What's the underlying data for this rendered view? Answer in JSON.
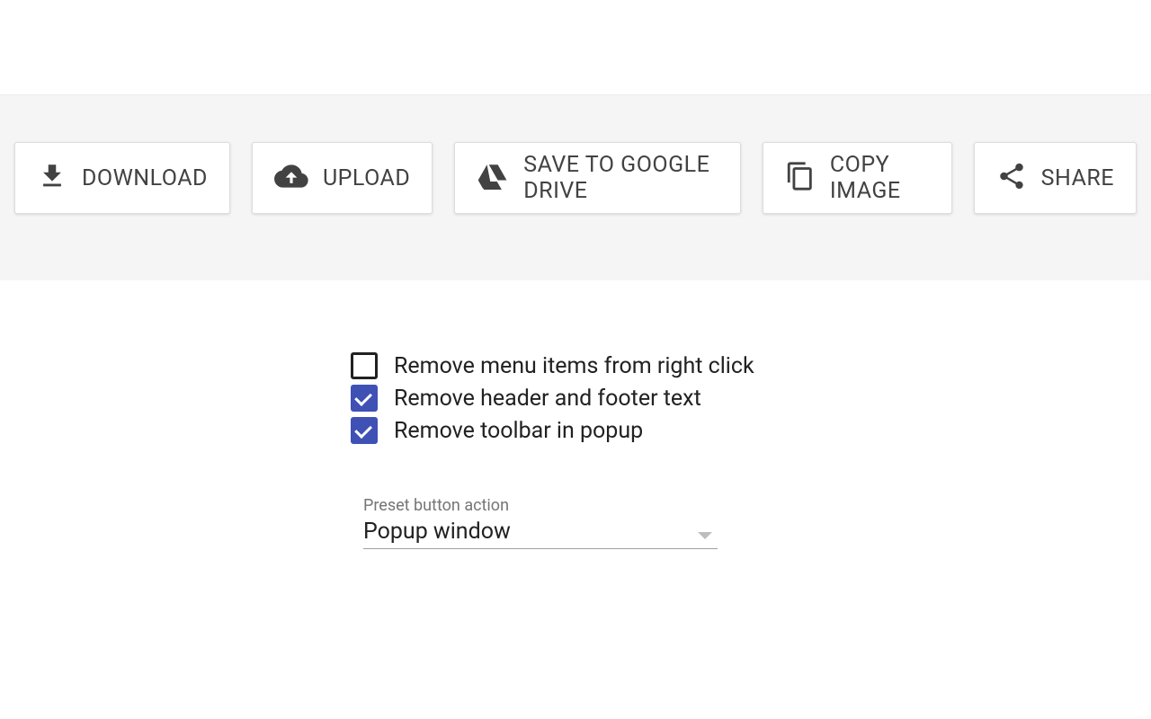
{
  "toolbar": {
    "download": "Download",
    "upload": "Upload",
    "drive": "Save to Google Drive",
    "copy": "Copy Image",
    "share": "Share"
  },
  "options": {
    "removeMenu": {
      "label": "Remove menu items from right click",
      "checked": false
    },
    "removeHeaderFooter": {
      "label": "Remove header and footer text",
      "checked": true
    },
    "removeToolbar": {
      "label": "Remove toolbar in popup",
      "checked": true
    }
  },
  "select": {
    "label": "Preset button action",
    "value": "Popup window"
  }
}
